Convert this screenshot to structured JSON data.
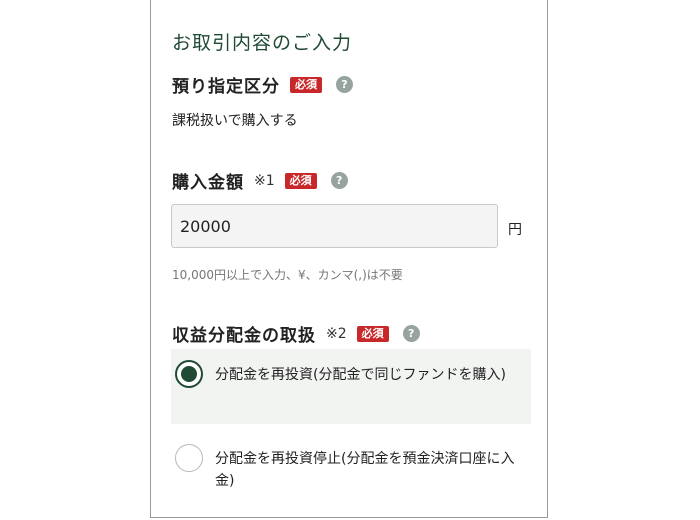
{
  "form": {
    "section_title": "お取引内容のご入力",
    "required_badge": "必須",
    "help_symbol": "?",
    "deposit_type": {
      "label": "預り指定区分",
      "value": "課税扱いで購入する"
    },
    "purchase_amount": {
      "label": "購入金額",
      "note": "※1",
      "value": "20000",
      "unit": "円",
      "hint": "10,000円以上で入力、¥、カンマ(,)は不要"
    },
    "distribution": {
      "label": "収益分配金の取扱",
      "note": "※2",
      "options": [
        {
          "label": "分配金を再投資(分配金で同じファンドを購入)",
          "selected": true
        },
        {
          "label": "分配金を再投資停止(分配金を預金決済口座に入金)",
          "selected": false
        }
      ]
    }
  },
  "colors": {
    "brand_green": "#1f4a33",
    "required_red": "#c8282a",
    "help_gray": "#97a39f",
    "selected_bg": "#f2f4f2"
  }
}
